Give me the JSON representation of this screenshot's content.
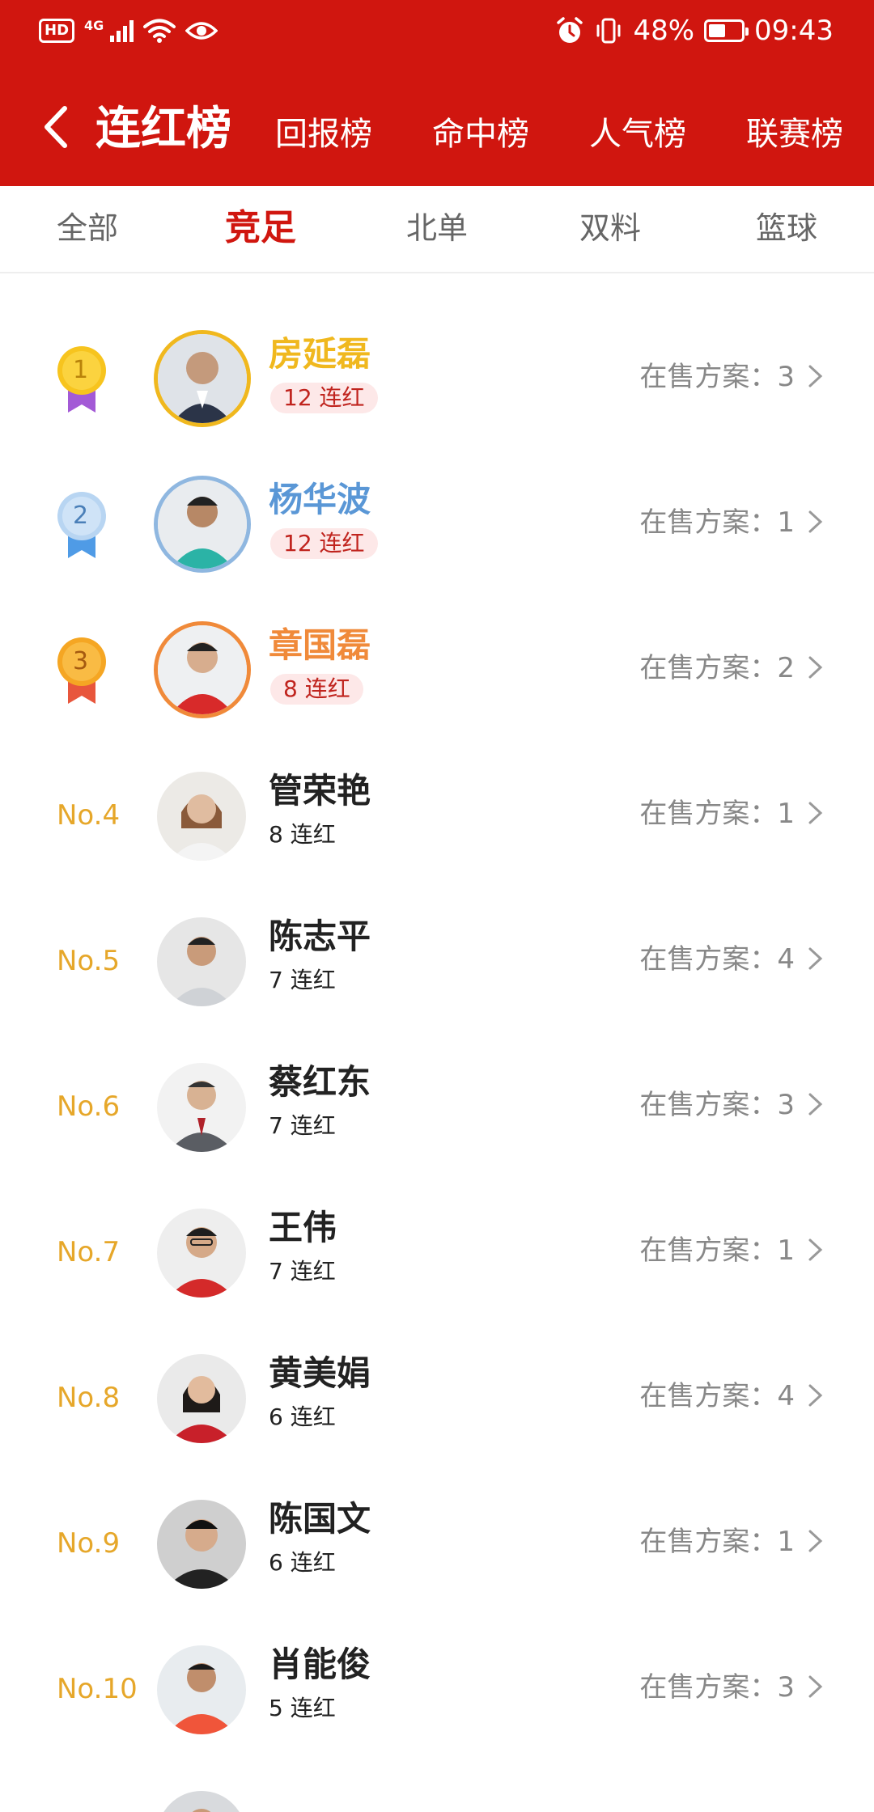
{
  "status_bar": {
    "hd": "HD",
    "network": "4G",
    "battery": "48%",
    "battery_level": 0.48,
    "time": "09:43"
  },
  "nav": {
    "title": "连红榜",
    "tabs": [
      "回报榜",
      "命中榜",
      "人气榜",
      "联赛榜"
    ]
  },
  "categories": {
    "items": [
      "全部",
      "竞足",
      "北单",
      "双料",
      "篮球"
    ],
    "active": "竞足"
  },
  "sale_label": "在售方案：",
  "colors": {
    "brand_red": "#d0160f",
    "gold": "#f0b81e",
    "silver": "#6ea5dc",
    "bronze": "#f08a3a",
    "rank_text": "#e6a72a"
  },
  "list": [
    {
      "rank": "1",
      "name": "房延磊",
      "streak": "12 连红",
      "sale_count": "3"
    },
    {
      "rank": "2",
      "name": "杨华波",
      "streak": "12 连红",
      "sale_count": "1"
    },
    {
      "rank": "3",
      "name": "章国磊",
      "streak": "8 连红",
      "sale_count": "2"
    },
    {
      "rank": "No.4",
      "name": "管荣艳",
      "streak": "8 连红",
      "sale_count": "1"
    },
    {
      "rank": "No.5",
      "name": "陈志平",
      "streak": "7 连红",
      "sale_count": "4"
    },
    {
      "rank": "No.6",
      "name": "蔡红东",
      "streak": "7 连红",
      "sale_count": "3"
    },
    {
      "rank": "No.7",
      "name": "王伟",
      "streak": "7 连红",
      "sale_count": "1"
    },
    {
      "rank": "No.8",
      "name": "黄美娟",
      "streak": "6 连红",
      "sale_count": "4"
    },
    {
      "rank": "No.9",
      "name": "陈国文",
      "streak": "6 连红",
      "sale_count": "1"
    },
    {
      "rank": "No.10",
      "name": "肖能俊",
      "streak": "5 连红",
      "sale_count": "3"
    }
  ]
}
